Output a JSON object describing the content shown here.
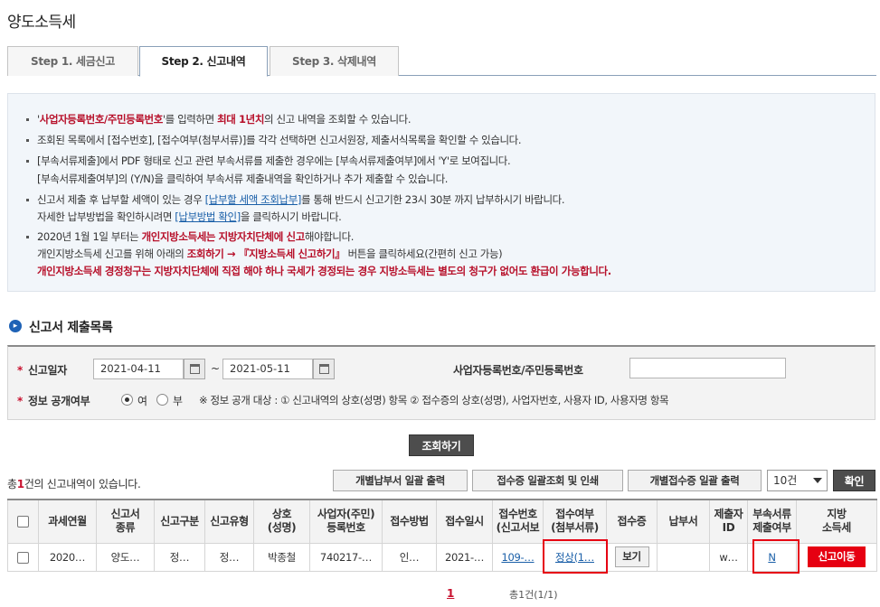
{
  "page": {
    "title": "양도소득세"
  },
  "tabs": [
    {
      "label": "Step 1. 세금신고"
    },
    {
      "label": "Step 2. 신고내역"
    },
    {
      "label": "Step 3. 삭제내역"
    }
  ],
  "notice": {
    "l1_pre": "'",
    "l1_red1": "사업자등록번호/주민등록번호",
    "l1_mid": "'를 입력하면 ",
    "l1_red2": "최대 1년치",
    "l1_post": "의 신고 내역을 조회할 수 있습니다.",
    "l2": "조회된 목록에서 [접수번호], [접수여부(첨부서류)]를 각각 선택하면 신고서원장, 제출서식목록을 확인할 수 있습니다.",
    "l3": "[부속서류제출]에서 PDF 형태로 신고 관련 부속서류를 제출한 경우에는 [부속서류제출여부]에서 'Y'로 보여집니다.",
    "l4": "[부속서류제출여부]의 (Y/N)을 클릭하여 부속서류 제출내역을 확인하거나 추가 제출할 수 있습니다.",
    "l5_pre": "신고서 제출 후 납부할 세액이 있는 경우 ",
    "l5_link": "[납부할 세액 조회납부]",
    "l5_post": "를 통해 반드시 신고기한 23시 30분 까지 납부하시기 바랍니다.",
    "l6_pre": "자세한 납부방법을 확인하시려면 ",
    "l6_link": "[납부방법 확인]",
    "l6_post": "을 클릭하시기 바랍니다.",
    "l7_pre": "2020년 1월 1일 부터는 ",
    "l7_red": "개인지방소득세는 지방자치단체에 신고",
    "l7_post": "해야합니다.",
    "l8_pre": "개인지방소득세 신고를 위해 아래의 ",
    "l8_red": "조회하기 → 『지방소득세 신고하기』",
    "l8_post": " 버튼을 클릭하세요(간편히 신고 가능)",
    "l9": "개인지방소득세 경정청구는 지방자치단체에 직접 해야 하나 국세가 경정되는 경우 지방소득세는 별도의 청구가 없어도 환급이 가능합니다."
  },
  "section": {
    "title": "신고서 제출목록"
  },
  "search": {
    "date_label": "신고일자",
    "date_from": "2021-04-11",
    "tilde": "~",
    "date_to": "2021-05-11",
    "id_label": "사업자등록번호/주민등록번호",
    "id_value": "",
    "public_label": "정보 공개여부",
    "yes": "여",
    "no": "부",
    "note": "※ 정보 공개 대상 : ① 신고내역의 상호(성명) 항목 ② 접수증의 상호(성명), 사업자번호, 사용자 ID, 사용자명 항목"
  },
  "buttons": {
    "search": "조회하기",
    "print_payment": "개별납부서 일괄 출력",
    "print_receipt_view": "접수증 일괄조회 및 인쇄",
    "print_receipt": "개별접수증 일괄 출력",
    "page_size": "10건",
    "confirm": "확인"
  },
  "summary": {
    "pre": "총",
    "count": "1",
    "post": "건의 신고내역이 있습니다."
  },
  "table": {
    "headers": {
      "year_month": "과세연월",
      "type1": "신고서",
      "type2": "종류",
      "category": "신고구분",
      "kind": "신고유형",
      "name1": "상호",
      "name2": "(성명)",
      "reg1": "사업자(주민)",
      "reg2": "등록번호",
      "method": "접수방법",
      "date": "접수일시",
      "no1": "접수번호",
      "no2": "(신고서보",
      "status1": "접수여부",
      "status2": "(첨부서류)",
      "receipt": "접수증",
      "payment": "납부서",
      "submitter1": "제출자",
      "submitter2": "ID",
      "attach1": "부속서류",
      "attach2": "제출여부",
      "local1": "지방",
      "local2": "소득세"
    },
    "rows": [
      {
        "year_month": "2020…",
        "type": "양도…",
        "category": "정…",
        "kind": "정…",
        "name": "박종철",
        "reg": "740217-…",
        "method": "인…",
        "date": "2021-…",
        "no": "109-…",
        "status": "정상(1…",
        "receipt": "보기",
        "payment": "",
        "submitter": "w…",
        "attach": "N",
        "local": "신고이동"
      }
    ]
  },
  "pagination": {
    "current": "1",
    "summary": "총1건(1/1)"
  },
  "colors": {
    "accent": "#1e62b6",
    "highlight": "#e60012",
    "emphasis": "#b7102a"
  }
}
